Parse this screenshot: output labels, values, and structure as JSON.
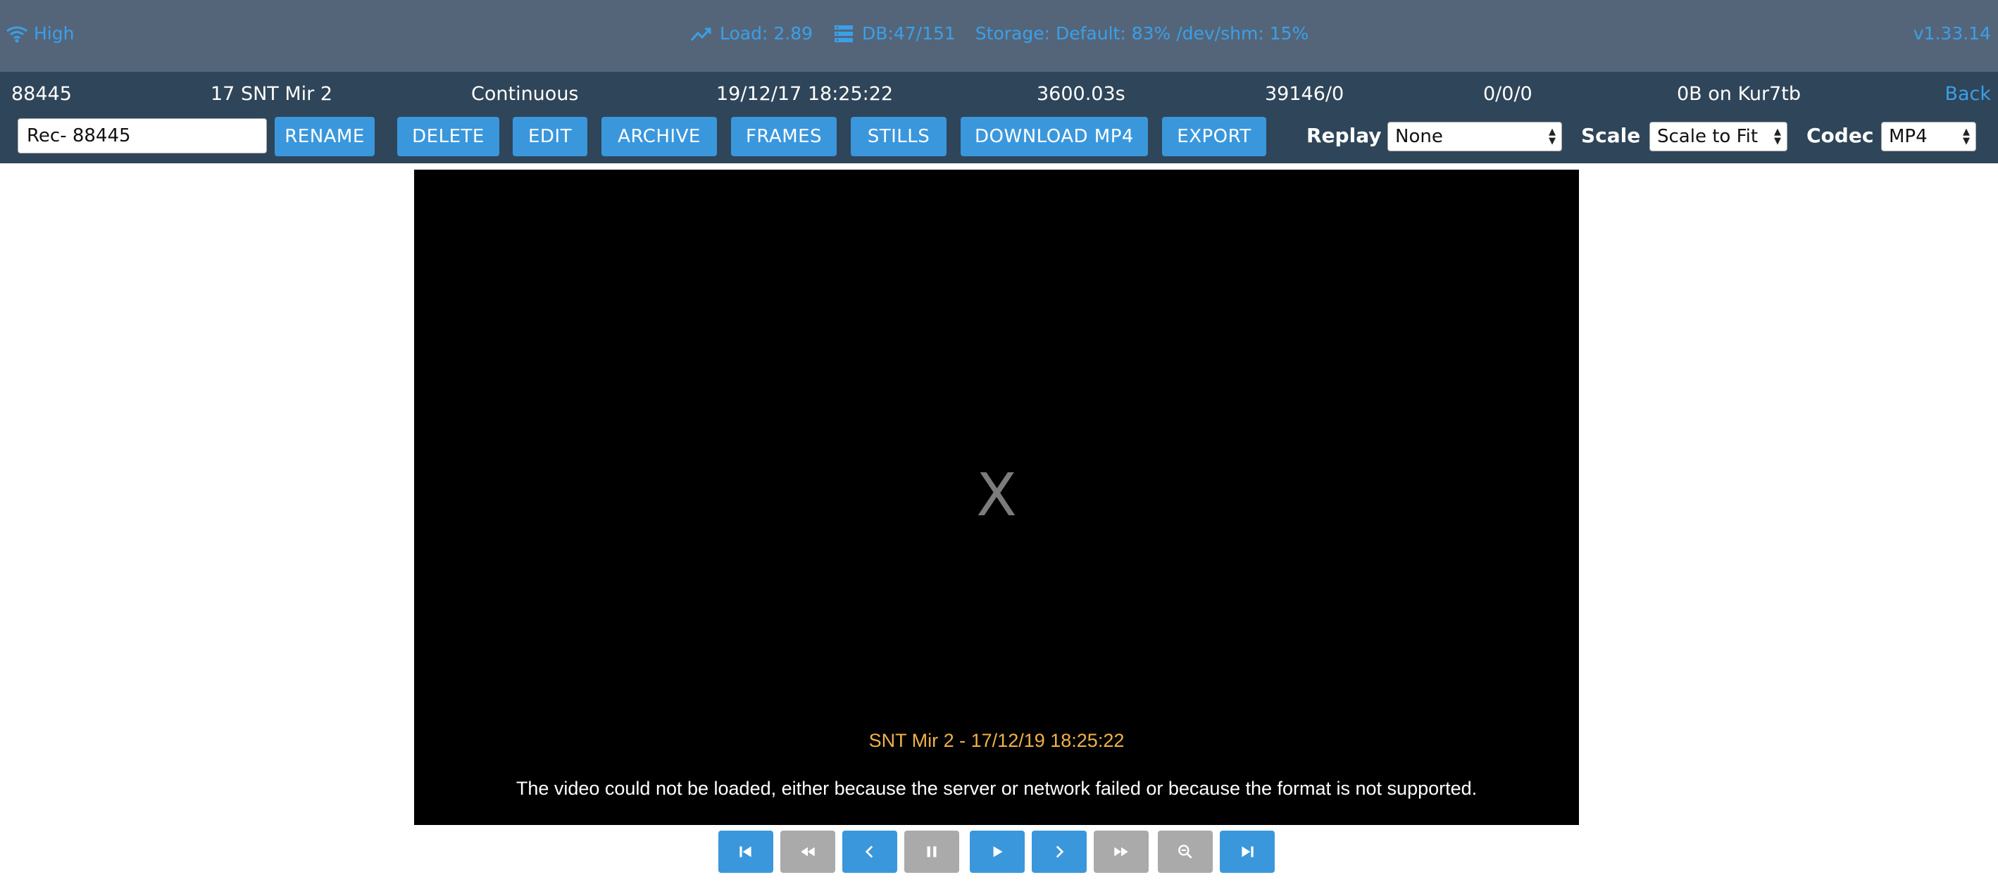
{
  "status": {
    "signal_label": "High",
    "load": "Load: 2.89",
    "db": "DB:47/151",
    "storage": "Storage: Default: 83% /dev/shm: 15%",
    "version": "v1.33.14"
  },
  "event_info": {
    "id": "88445",
    "monitor": "17 SNT Mir 2",
    "cause": "Continuous",
    "start_time": "19/12/17 18:25:22",
    "duration": "3600.03s",
    "frames": "39146/0",
    "scores": "0/0/0",
    "disk": "0B on Kur7tb",
    "back_label": "Back"
  },
  "toolbar": {
    "event_name_value": "Rec- 88445",
    "buttons": {
      "rename": "RENAME",
      "delete": "DELETE",
      "edit": "EDIT",
      "archive": "ARCHIVE",
      "frames": "FRAMES",
      "stills": "STILLS",
      "download_mp4": "DOWNLOAD MP4",
      "export": "EXPORT"
    },
    "replay_label": "Replay",
    "replay_value": "None",
    "scale_label": "Scale",
    "scale_value": "Scale to Fit",
    "codec_label": "Codec",
    "codec_value": "MP4"
  },
  "video": {
    "placeholder": "X",
    "caption": "SNT Mir 2 - 17/12/19 18:25:22",
    "error_message": "The video could not be loaded, either because the server or network failed or because the format is not supported."
  },
  "controls": [
    {
      "name": "prev-event-button",
      "icon": "skip-previous-icon",
      "enabled": true
    },
    {
      "name": "fast-rewind-button",
      "icon": "fast-rewind-icon",
      "enabled": false
    },
    {
      "name": "step-back-button",
      "icon": "chevron-left-icon",
      "enabled": true
    },
    {
      "name": "pause-button",
      "icon": "pause-icon",
      "enabled": false
    },
    {
      "name": "play-button",
      "icon": "play-icon",
      "enabled": true
    },
    {
      "name": "step-forward-button",
      "icon": "chevron-right-icon",
      "enabled": true
    },
    {
      "name": "fast-forward-button",
      "icon": "fast-forward-icon",
      "enabled": false
    },
    {
      "name": "zoom-out-button",
      "icon": "zoom-out-icon",
      "enabled": false
    },
    {
      "name": "next-event-button",
      "icon": "skip-next-icon",
      "enabled": true
    }
  ],
  "colors": {
    "accent_blue": "#3a97dc",
    "status_bar": "#54657a",
    "info_bar": "#2f4559",
    "caption": "#f0b24a"
  }
}
